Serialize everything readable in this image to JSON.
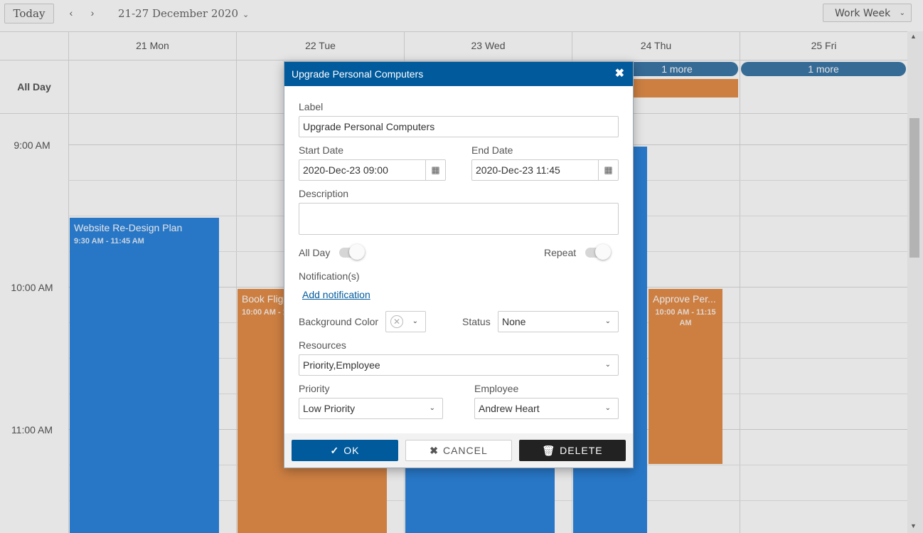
{
  "toolbar": {
    "today_label": "Today",
    "prev_icon": "‹",
    "next_icon": "›",
    "date_range": "21-27 December 2020",
    "chevron": "⌄",
    "view_label": "Work Week"
  },
  "days": [
    {
      "label": "21 Mon"
    },
    {
      "label": "22 Tue"
    },
    {
      "label": "23 Wed"
    },
    {
      "label": "24 Thu"
    },
    {
      "label": "25 Fri"
    }
  ],
  "all_day": {
    "label": "All Day",
    "more_thu": "1 more",
    "more_fri": "1 more"
  },
  "time_labels": {
    "t9": "9:00 AM",
    "t10": "10:00 AM",
    "t11": "11:00 AM"
  },
  "events": {
    "website": {
      "title": "Website Re-Design Plan",
      "time": "9:30 AM - 11:45 AM"
    },
    "book": {
      "title": "Book Flig",
      "time": "10:00 AM - 1"
    },
    "approve": {
      "title": "Approve Per...",
      "time": "10:00 AM - 11:15 AM"
    }
  },
  "dialog": {
    "title": "Upgrade Personal Computers",
    "close_icon": "✖",
    "label_label": "Label",
    "label_value": "Upgrade Personal Computers",
    "start_label": "Start Date",
    "start_value": "2020-Dec-23 09:00",
    "end_label": "End Date",
    "end_value": "2020-Dec-23 11:45",
    "calendar_icon": "▦",
    "description_label": "Description",
    "description_value": "",
    "allday_label": "All Day",
    "repeat_label": "Repeat",
    "notifications_label": "Notification(s)",
    "add_notification": "Add notification",
    "bg_color_label": "Background Color",
    "status_label": "Status",
    "status_value": "None",
    "resources_label": "Resources",
    "resources_value": "Priority,Employee",
    "priority_label": "Priority",
    "priority_value": "Low Priority",
    "employee_label": "Employee",
    "employee_value": "Andrew Heart",
    "ok_label": "OK",
    "cancel_label": "CANCEL",
    "delete_label": "DELETE",
    "ok_icon": "✓",
    "cancel_icon": "✖",
    "delete_icon": "🗑"
  },
  "colors": {
    "accent": "#005a9c",
    "event_blue": "#2d85de",
    "event_orange": "#e58e4a"
  }
}
